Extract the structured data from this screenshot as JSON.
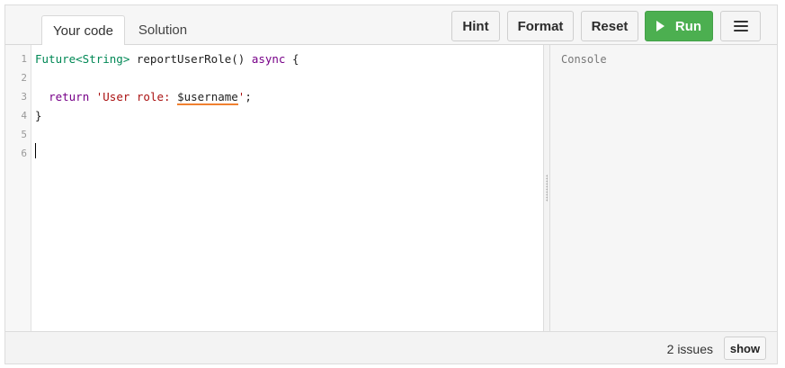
{
  "tabs": {
    "your_code": "Your code",
    "solution": "Solution"
  },
  "toolbar": {
    "hint_label": "Hint",
    "format_label": "Format",
    "reset_label": "Reset",
    "run_label": "Run",
    "run_icon": "play-icon",
    "menu_icon": "hamburger-menu-icon",
    "run_color": "#4caf50"
  },
  "editor": {
    "line_numbers": [
      "1",
      "2",
      "3",
      "4",
      "5",
      "6"
    ],
    "lines": {
      "l1": {
        "type": "Future<String>",
        "rest": " reportUserRole() ",
        "kw": "async",
        "tail": " {"
      },
      "l3": {
        "kw": "return",
        "str_open": " 'User role: ",
        "var": "$username",
        "str_close": "'",
        "end": ";"
      },
      "l4": "}"
    },
    "warning_color": "#f08030"
  },
  "console": {
    "label": "Console"
  },
  "status": {
    "issues_text": "2 issues",
    "show_label": "show"
  }
}
